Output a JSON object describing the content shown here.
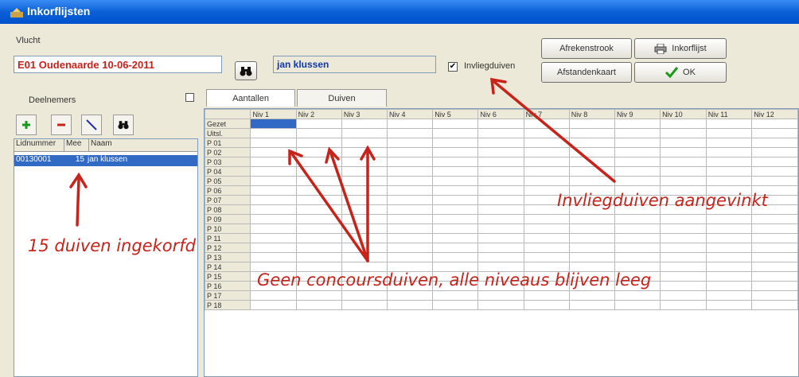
{
  "window": {
    "title": "Inkorflijsten"
  },
  "flight": {
    "label": "Vlucht",
    "value": "E01 Oudenaarde 10-06-2011"
  },
  "member_field": {
    "value": "jan klussen"
  },
  "checkbox": {
    "label": "Invliegduiven",
    "checked": true
  },
  "buttons": {
    "afrekenstrook": "Afrekenstrook",
    "afstandenkaart": "Afstandenkaart",
    "inkorflijst": "Inkorflijst",
    "ok": "OK"
  },
  "participants": {
    "title": "Deelnemers",
    "columns": [
      "Lidnummer",
      "Mee",
      "Naam"
    ],
    "rows": [
      {
        "lidnummer": "00130001",
        "mee": "15",
        "naam": "jan klussen"
      }
    ]
  },
  "tabs": [
    "Aantallen",
    "Duiven"
  ],
  "grid": {
    "columns": [
      "Niv 1",
      "Niv 2",
      "Niv 3",
      "Niv 4",
      "Niv 5",
      "Niv 6",
      "Niv 7",
      "Niv 8",
      "Niv 9",
      "Niv 10",
      "Niv 11",
      "Niv 12"
    ],
    "rows": [
      "Gezet",
      "Uitsl.",
      "P 01",
      "P 02",
      "P 03",
      "P 04",
      "P 05",
      "P 06",
      "P 07",
      "P 08",
      "P 09",
      "P 10",
      "P 11",
      "P 12",
      "P 13",
      "P 14",
      "P 15",
      "P 16",
      "P 17",
      "P 18"
    ]
  },
  "annotations": {
    "ingekorfd": "15 duiven ingekorfd",
    "aangevinkt": "Invliegduiven aangevinkt",
    "concours": "Geen concoursduiven, alle niveaus blijven leeg"
  },
  "colors": {
    "accent": "#0052cc",
    "annotation": "#c8231b",
    "selection": "#316ac5"
  }
}
